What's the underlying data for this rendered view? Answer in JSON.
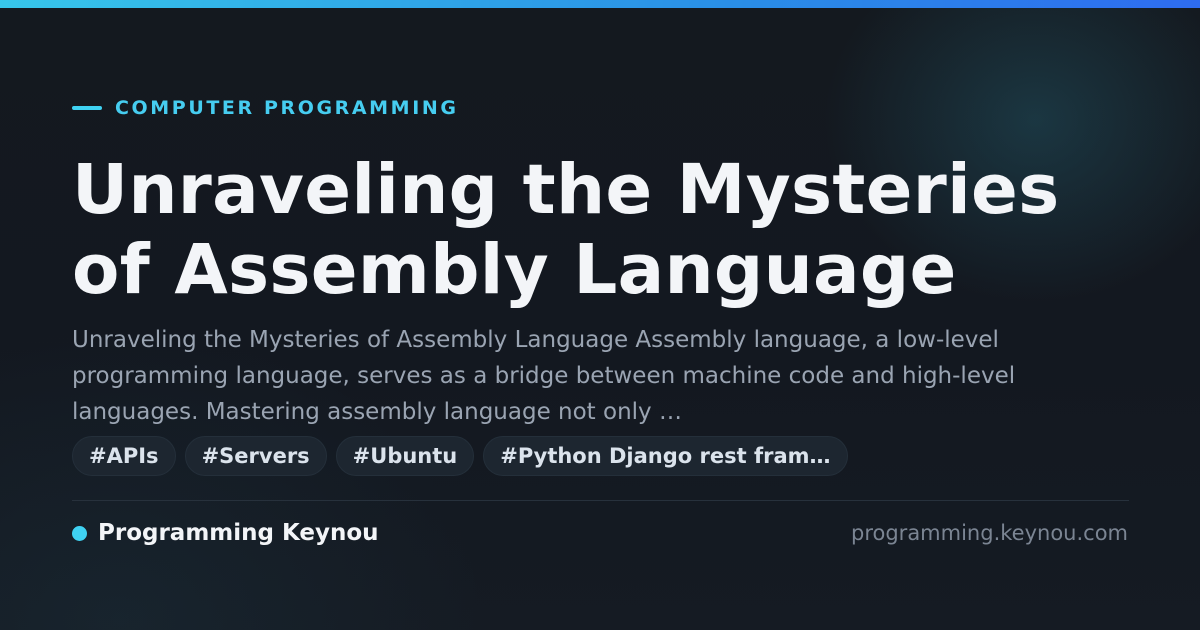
{
  "category": {
    "label": "COMPUTER PROGRAMMING"
  },
  "title": "Unraveling the Mysteries of Assembly Language",
  "excerpt": "Unraveling the Mysteries of Assembly Language Assembly language, a low-level programming language, serves as a bridge between machine code and high-level languages. Mastering assembly language not only …",
  "tags": [
    "#APIs",
    "#Servers",
    "#Ubuntu",
    "#Python Django rest fram…"
  ],
  "footer": {
    "brand_name": "Programming Keynou",
    "site_url": "programming.keynou.com"
  },
  "colors": {
    "accent": "#3fd2f2",
    "top_bar_gradient": [
      "#37c6ea",
      "#2e6cf0"
    ],
    "background": "#13181f"
  }
}
